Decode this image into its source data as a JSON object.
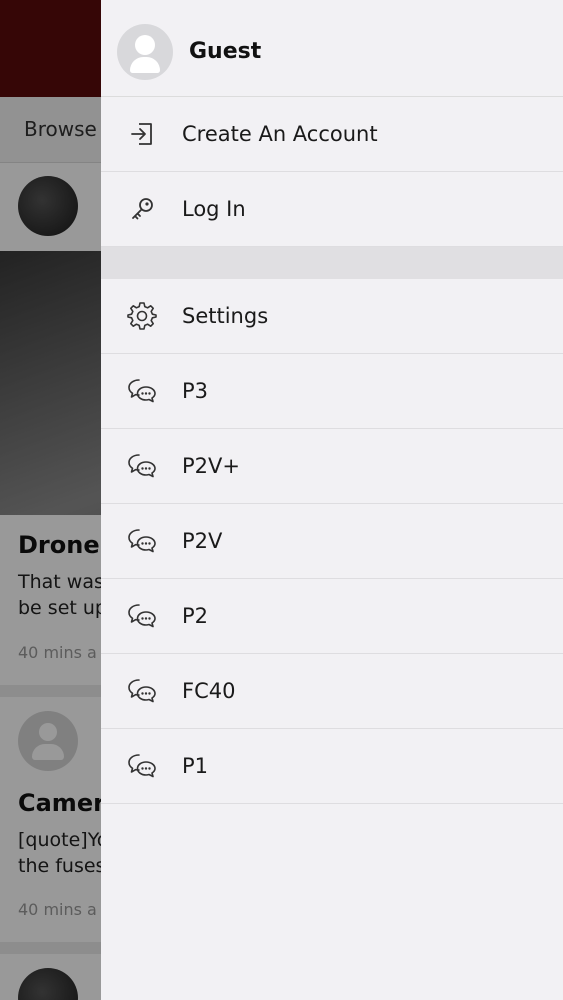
{
  "background": {
    "tab_label": "Browse",
    "cards": [
      {
        "title": "Drone v",
        "excerpt": "That was\nbe set up",
        "time": "40 mins a"
      },
      {
        "title": "Camera",
        "excerpt": "[quote]Yo\nthe fuses",
        "time": "40 mins a"
      }
    ]
  },
  "drawer": {
    "user": {
      "name": "Guest"
    },
    "account_items": [
      {
        "label": "Create An Account",
        "icon": "sign-in-icon"
      },
      {
        "label": "Log In",
        "icon": "key-icon"
      }
    ],
    "settings": {
      "label": "Settings",
      "icon": "gear-icon"
    },
    "forums": [
      {
        "label": "P3",
        "icon": "chat-bubbles-icon"
      },
      {
        "label": "P2V+",
        "icon": "chat-bubbles-icon"
      },
      {
        "label": "P2V",
        "icon": "chat-bubbles-icon"
      },
      {
        "label": "P2",
        "icon": "chat-bubbles-icon"
      },
      {
        "label": "FC40",
        "icon": "chat-bubbles-icon"
      },
      {
        "label": "P1",
        "icon": "chat-bubbles-icon"
      }
    ]
  },
  "colors": {
    "header": "#5a0a0a",
    "drawer_bg": "#f2f1f4",
    "text": "#1a1a1a"
  }
}
